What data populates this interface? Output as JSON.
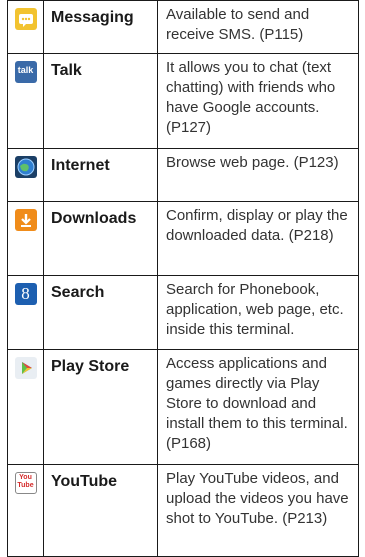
{
  "apps": [
    {
      "icon": "messaging-icon",
      "name": "Messaging",
      "description": "Available to send and receive SMS. (P115)"
    },
    {
      "icon": "talk-icon",
      "icon_text": "talk",
      "name": "Talk",
      "description": "It allows you to chat (text chatting) with friends who have Google accounts. (P127)"
    },
    {
      "icon": "internet-icon",
      "name": "Internet",
      "description": "Browse web page. (P123)"
    },
    {
      "icon": "downloads-icon",
      "name": "Downloads",
      "description": "Confirm, display or play the downloaded data. (P218)"
    },
    {
      "icon": "search-icon",
      "icon_text": "8",
      "name": "Search",
      "description": "Search for Phonebook, application, web page, etc. inside this terminal."
    },
    {
      "icon": "play-store-icon",
      "name": "Play Store",
      "description": "Access applications and games directly via Play Store to download and install them to this terminal. (P168)"
    },
    {
      "icon": "youtube-icon",
      "icon_text": "You Tube",
      "name": "YouTube",
      "description": "Play YouTube videos, and upload the videos you have shot to YouTube. (P213)"
    }
  ],
  "colors": {
    "messaging": "#f2c330",
    "talk": "#3a6aa8",
    "internet": "#2f7fd0",
    "downloads": "#f08c1a",
    "search": "#1d5fb0",
    "play_store": "#e9eef3",
    "youtube": "#d42a2a"
  }
}
